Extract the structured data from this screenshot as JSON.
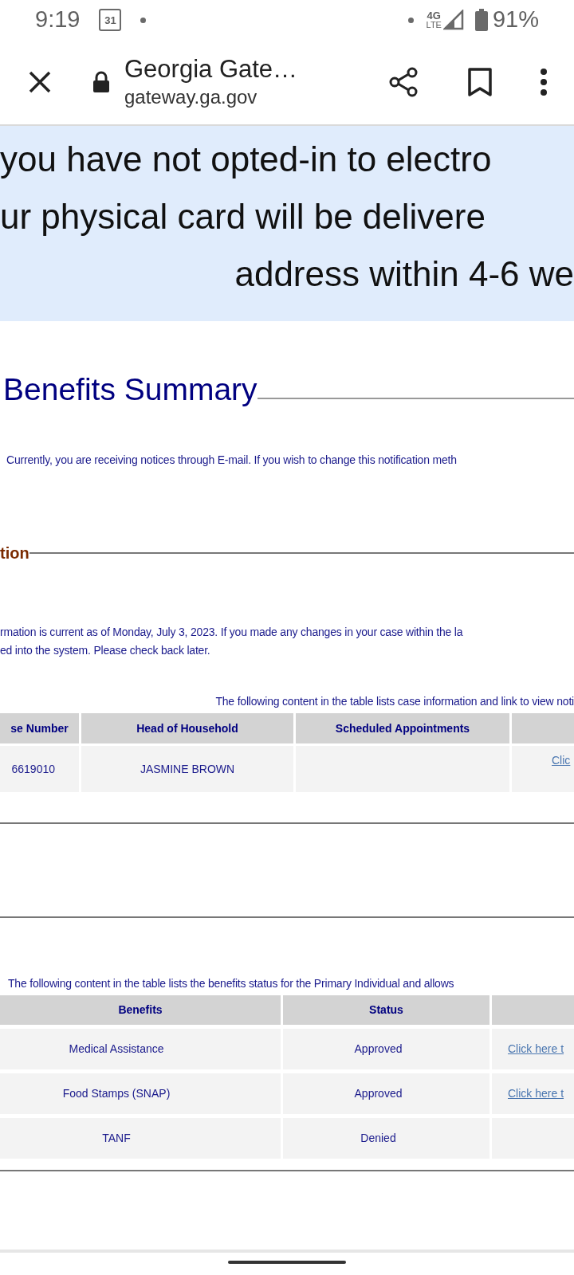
{
  "status_bar": {
    "time": "9:19",
    "calendar_day": "31",
    "network": "4G",
    "network_sub": "LTE",
    "battery": "91%"
  },
  "browser": {
    "title": "Georgia Gate…",
    "url": "gateway.ga.gov"
  },
  "banner": {
    "lines": [
      "you have not opted-in to electro",
      "ur physical card will be delivere",
      "address within 4-6 we"
    ]
  },
  "benefits_summary": {
    "title": "Benefits Summary",
    "notice": "Currently, you are receiving notices through E-mail. If you wish to change this notification meth"
  },
  "case_section": {
    "heading": "tion",
    "info_lines": [
      "rmation is current as of Monday, July 3, 2023. If you made any changes in your case within the la",
      "ed into the system. Please check back later."
    ],
    "caption": "The following content in the table lists case information and link to view noti",
    "columns": [
      "se Number",
      "Head of Household",
      "Scheduled Appointments"
    ],
    "rows": [
      {
        "case_number": "6619010",
        "head_of_household": "JASMINE BROWN",
        "link": "Clic"
      }
    ]
  },
  "benefits_table": {
    "caption": "The following content in the table lists the benefits status for the Primary Individual and allows",
    "columns": [
      "Benefits",
      "Status"
    ],
    "rows": [
      {
        "benefit": "Medical Assistance",
        "status": "Approved",
        "link": "Click here t"
      },
      {
        "benefit": "Food Stamps (SNAP)",
        "status": "Approved",
        "link": "Click here t"
      },
      {
        "benefit": "TANF",
        "status": "Denied"
      }
    ]
  }
}
